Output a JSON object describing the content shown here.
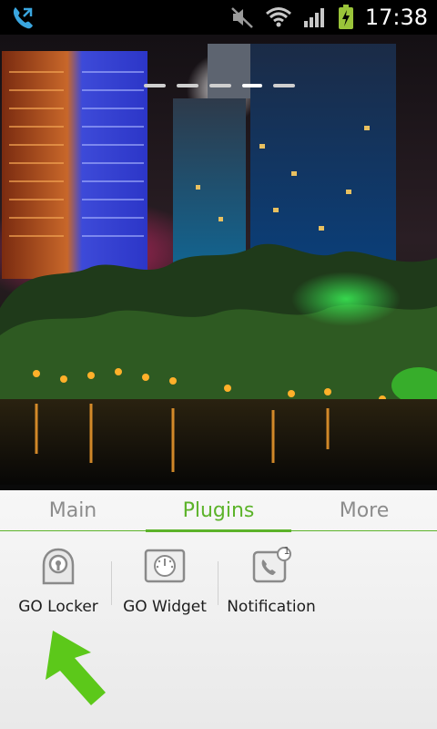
{
  "status_bar": {
    "time": "17:38",
    "icons": [
      "phone-call-icon",
      "muted-speaker-icon",
      "wifi-icon",
      "signal-icon",
      "battery-charging-icon"
    ]
  },
  "home": {
    "page_count": 5,
    "active_page": 4
  },
  "tabs": [
    {
      "label": "Main",
      "active": false
    },
    {
      "label": "Plugins",
      "active": true
    },
    {
      "label": "More",
      "active": false
    }
  ],
  "plugins": [
    {
      "label": "GO Locker",
      "icon": "lock-icon"
    },
    {
      "label": "GO Widget",
      "icon": "widget-gauge-icon"
    },
    {
      "label": "Notification",
      "icon": "notification-phone-icon",
      "badge": "1"
    }
  ],
  "colors": {
    "accent": "#5cb32a",
    "tab_inactive": "#8c8c8c",
    "arrow": "#5cc81a"
  }
}
